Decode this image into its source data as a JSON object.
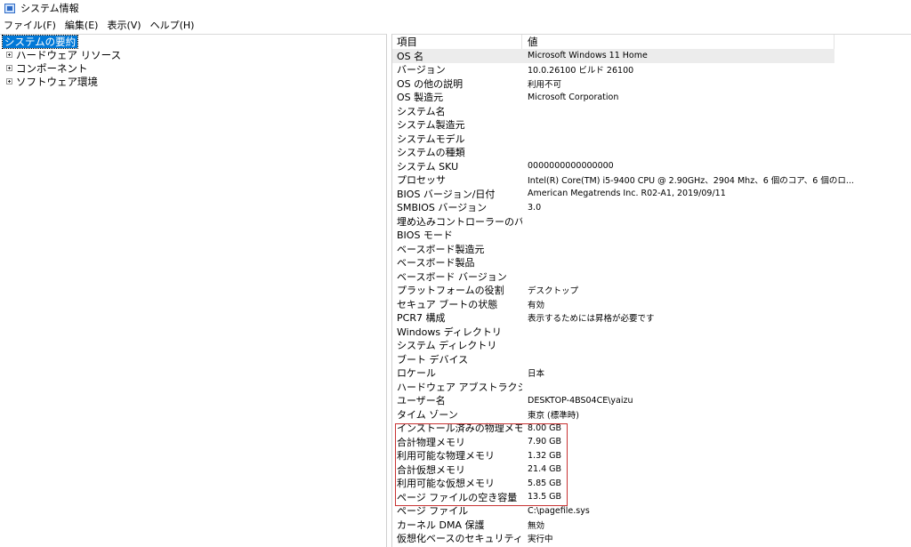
{
  "window": {
    "title": "システム情報",
    "icon": "system-info-icon",
    "accent": "#0078d7",
    "highlight_box_color": "#c83232"
  },
  "menu": [
    "ファイル(F)",
    "編集(E)",
    "表示(V)",
    "ヘルプ(H)"
  ],
  "tree": {
    "selected": "システムの要約",
    "children": [
      "ハードウェア リソース",
      "コンポーネント",
      "ソフトウェア環境"
    ]
  },
  "table": {
    "headers": {
      "item": "項目",
      "value": "値"
    },
    "rows": [
      {
        "item": "OS 名",
        "value": "Microsoft Windows 11 Home"
      },
      {
        "item": "バージョン",
        "value": "10.0.26100 ビルド 26100"
      },
      {
        "item": "OS の他の説明",
        "value": "利用不可"
      },
      {
        "item": "OS 製造元",
        "value": "Microsoft Corporation"
      },
      {
        "item": "システム名",
        "value": ""
      },
      {
        "item": "システム製造元",
        "value": ""
      },
      {
        "item": "システムモデル",
        "value": ""
      },
      {
        "item": "システムの種類",
        "value": ""
      },
      {
        "item": "システム SKU",
        "value": "0000000000000000"
      },
      {
        "item": "プロセッサ",
        "value": "Intel(R) Core(TM) i5-9400 CPU @ 2.90GHz、2904 Mhz、6 個のコア、6 個のロ..."
      },
      {
        "item": "BIOS バージョン/日付",
        "value": "American Megatrends Inc. R02-A1, 2019/09/11"
      },
      {
        "item": "SMBIOS バージョン",
        "value": "3.0"
      },
      {
        "item": "埋め込みコントローラーのバー...",
        "value": ""
      },
      {
        "item": "BIOS モード",
        "value": ""
      },
      {
        "item": "ベースボード製造元",
        "value": ""
      },
      {
        "item": "ベースボード製品",
        "value": ""
      },
      {
        "item": "ベースボード バージョン",
        "value": ""
      },
      {
        "item": "プラットフォームの役割",
        "value": "デスクトップ"
      },
      {
        "item": "セキュア ブートの状態",
        "value": "有効"
      },
      {
        "item": "PCR7 構成",
        "value": "表示するためには昇格が必要です"
      },
      {
        "item": "Windows ディレクトリ",
        "value": ""
      },
      {
        "item": "システム ディレクトリ",
        "value": ""
      },
      {
        "item": "ブート デバイス",
        "value": ""
      },
      {
        "item": "ロケール",
        "value": "日本"
      },
      {
        "item": "ハードウェア アブストラクション ...",
        "value": ""
      },
      {
        "item": "ユーザー名",
        "value": "DESKTOP-4BS04CE\\yaizu"
      },
      {
        "item": "タイム ゾーン",
        "value": "東京 (標準時)"
      },
      {
        "item": "インストール済みの物理メモリ...",
        "value": "8.00 GB"
      },
      {
        "item": "合計物理メモリ",
        "value": "7.90 GB"
      },
      {
        "item": "利用可能な物理メモリ",
        "value": "1.32 GB"
      },
      {
        "item": "合計仮想メモリ",
        "value": "21.4 GB"
      },
      {
        "item": "利用可能な仮想メモリ",
        "value": "5.85 GB"
      },
      {
        "item": "ページ ファイルの空き容量",
        "value": "13.5 GB"
      },
      {
        "item": "ページ ファイル",
        "value": "C:\\pagefile.sys"
      },
      {
        "item": "カーネル DMA 保護",
        "value": "無効"
      },
      {
        "item": "仮想化ベースのセキュリティ",
        "value": "実行中"
      }
    ]
  }
}
